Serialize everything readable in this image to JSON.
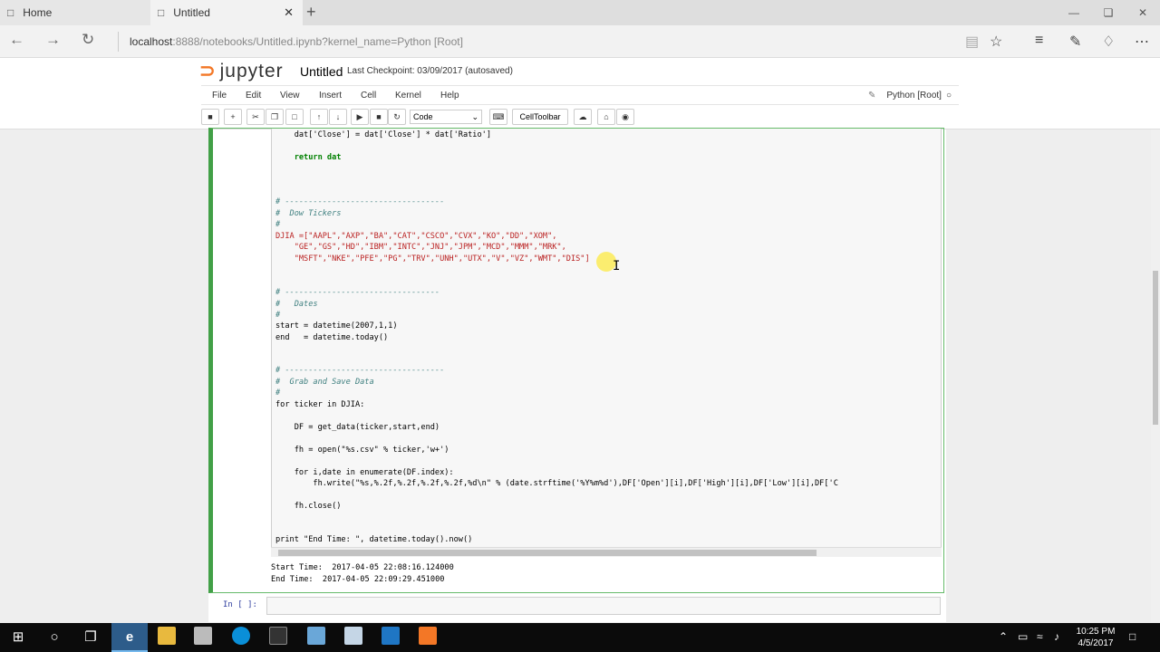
{
  "browser": {
    "tabs": [
      {
        "label": "Home"
      },
      {
        "label": "Untitled"
      }
    ],
    "url_host": "localhost",
    "url_rest": ":8888/notebooks/Untitled.ipynb?kernel_name=Python [Root]"
  },
  "jupyter": {
    "logo": "jupyter",
    "notebook_title": "Untitled",
    "checkpoint": "Last Checkpoint: 03/09/2017 (autosaved)",
    "menu": [
      "File",
      "Edit",
      "View",
      "Insert",
      "Cell",
      "Kernel",
      "Help"
    ],
    "kernel_name": "Python [Root]",
    "cell_type": "Code",
    "celltoolbar_label": "CellToolbar"
  },
  "code": {
    "l1": "    dat['Close'] = dat['Close'] * dat['Ratio']",
    "l2": "    return dat",
    "l3": "# ----------------------------------",
    "l4": "#  Dow Tickers",
    "l5": "#",
    "l6": "DJIA =[\"AAPL\",\"AXP\",\"BA\",\"CAT\",\"CSCO\",\"CVX\",\"KO\",\"DD\",\"XOM\",",
    "l7": "    \"GE\",\"GS\",\"HD\",\"IBM\",\"INTC\",\"JNJ\",\"JPM\",\"MCD\",\"MMM\",\"MRK\",",
    "l8": "    \"MSFT\",\"NKE\",\"PFE\",\"PG\",\"TRV\",\"UNH\",\"UTX\",\"V\",\"VZ\",\"WMT\",\"DIS\"]",
    "l9": "# ---------------------------------",
    "l10": "#   Dates",
    "l11": "#",
    "l12": "start = datetime(2007,1,1)",
    "l13": "end   = datetime.today()",
    "l14": "# ----------------------------------",
    "l15": "#  Grab and Save Data",
    "l16": "#",
    "l17": "for ticker in DJIA:",
    "l18": "    DF = get_data(ticker,start,end)",
    "l19": "    fh = open(\"%s.csv\" % ticker,'w+')",
    "l20": "    for i,date in enumerate(DF.index):",
    "l21": "        fh.write(\"%s,%.2f,%.2f,%.2f,%.2f,%d\\n\" % (date.strftime('%Y%m%d'),DF['Open'][i],DF['High'][i],DF['Low'][i],DF['C",
    "l22": "    fh.close()",
    "l23": "print \"End Time: \", datetime.today().now()"
  },
  "output": {
    "start": "Start Time:  2017-04-05 22:08:16.124000",
    "end": "End Time:  2017-04-05 22:09:29.451000"
  },
  "next_cell_prompt": "In [ ]:",
  "taskbar": {
    "time": "10:25 PM",
    "date": "4/5/2017"
  },
  "colors": {
    "jupyter_orange": "#f37726",
    "selected_cell_border": "#42a047",
    "edge_blue": "#2d5c8a"
  }
}
